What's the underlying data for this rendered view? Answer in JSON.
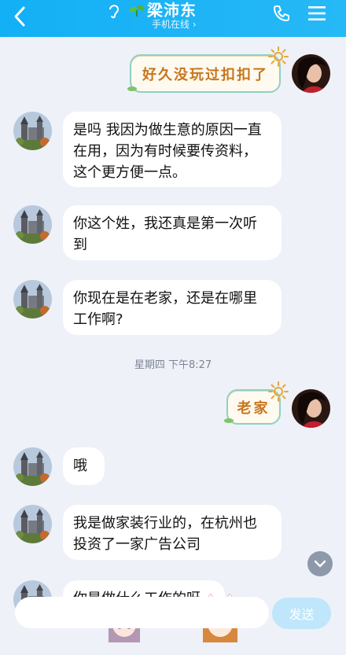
{
  "header": {
    "contact_name": "梁沛东",
    "status": "手机在线 ›"
  },
  "messages": {
    "sticker1": "好久没玩过扣扣了",
    "in1": "是吗 我因为做生意的原因一直在用，因为有时候要传资料，这个更方便一点。",
    "in2": "你这个姓，我还真是第一次听到",
    "in3": "你现在是在老家，还是在哪里工作啊?",
    "timestamp": "星期四 下午8:27",
    "sticker2": "老家",
    "in4": "哦",
    "in5": "我是做家装行业的，在杭州也投资了一家广告公司",
    "in6": "你是做什么工作的呀"
  },
  "composer": {
    "send_label": "发送"
  },
  "colors": {
    "header_bg": "#1fb4f6",
    "chat_bg": "#eef1f8",
    "send_button": "#bfe6fb"
  }
}
